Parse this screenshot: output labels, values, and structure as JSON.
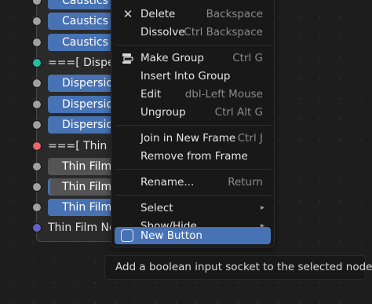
{
  "node_panel": {
    "items": [
      {
        "text": "Caustics R",
        "style": "blue",
        "socket": "gray"
      },
      {
        "text": "Caustics F",
        "style": "blue",
        "socket": "gray"
      },
      {
        "text": "Caustics F",
        "style": "blue",
        "socket": "gray"
      },
      {
        "text": "===[ Dispe",
        "style": "frame",
        "socket": "teal"
      },
      {
        "text": "Dispersion",
        "style": "blue",
        "socket": "gray"
      },
      {
        "text": "Dispersion",
        "style": "blue",
        "socket": "gray"
      },
      {
        "text": "Dispersion",
        "style": "blue",
        "socket": "gray"
      },
      {
        "text": "===[ Thin F",
        "style": "frame",
        "socket": "red"
      },
      {
        "text": "Thin Film",
        "style": "gray",
        "socket": "gray"
      },
      {
        "text": "Thin Film",
        "style": "gray-marked",
        "socket": "gray"
      },
      {
        "text": "Thin Film",
        "style": "blue",
        "socket": "gray"
      },
      {
        "text": "Thin Film No",
        "style": "plain",
        "socket": "purple"
      }
    ]
  },
  "menu": {
    "delete": {
      "label": "Delete",
      "shortcut": "Backspace"
    },
    "dissolve": {
      "label": "Dissolve",
      "shortcut": "Ctrl Backspace"
    },
    "make_group": {
      "label": "Make Group",
      "shortcut": "Ctrl G"
    },
    "insert_into_group": {
      "label": "Insert Into Group"
    },
    "edit": {
      "label": "Edit",
      "shortcut": "dbl-Left Mouse"
    },
    "ungroup": {
      "label": "Ungroup",
      "shortcut": "Ctrl Alt G"
    },
    "join_in_new_frame": {
      "label": "Join in New Frame",
      "shortcut": "Ctrl J"
    },
    "remove_from_frame": {
      "label": "Remove from Frame"
    },
    "rename": {
      "label": "Rename...",
      "shortcut": "Return"
    },
    "select": {
      "label": "Select",
      "arrow": "▸"
    },
    "show_hide": {
      "label": "Show/Hide",
      "arrow": "▸"
    },
    "new_button": {
      "label": "New Button"
    }
  },
  "icons": {
    "delete": "✕",
    "make_group": "node-group-icon",
    "new_button": "checkbox-icon"
  },
  "tooltip": {
    "text": "Add a boolean input socket to the selected node."
  },
  "colors": {
    "accent": "#4772b3",
    "menu_bg": "#181818",
    "socket_teal": "#22c1a0",
    "socket_red": "#e8666c",
    "socket_purple": "#6363c7"
  }
}
